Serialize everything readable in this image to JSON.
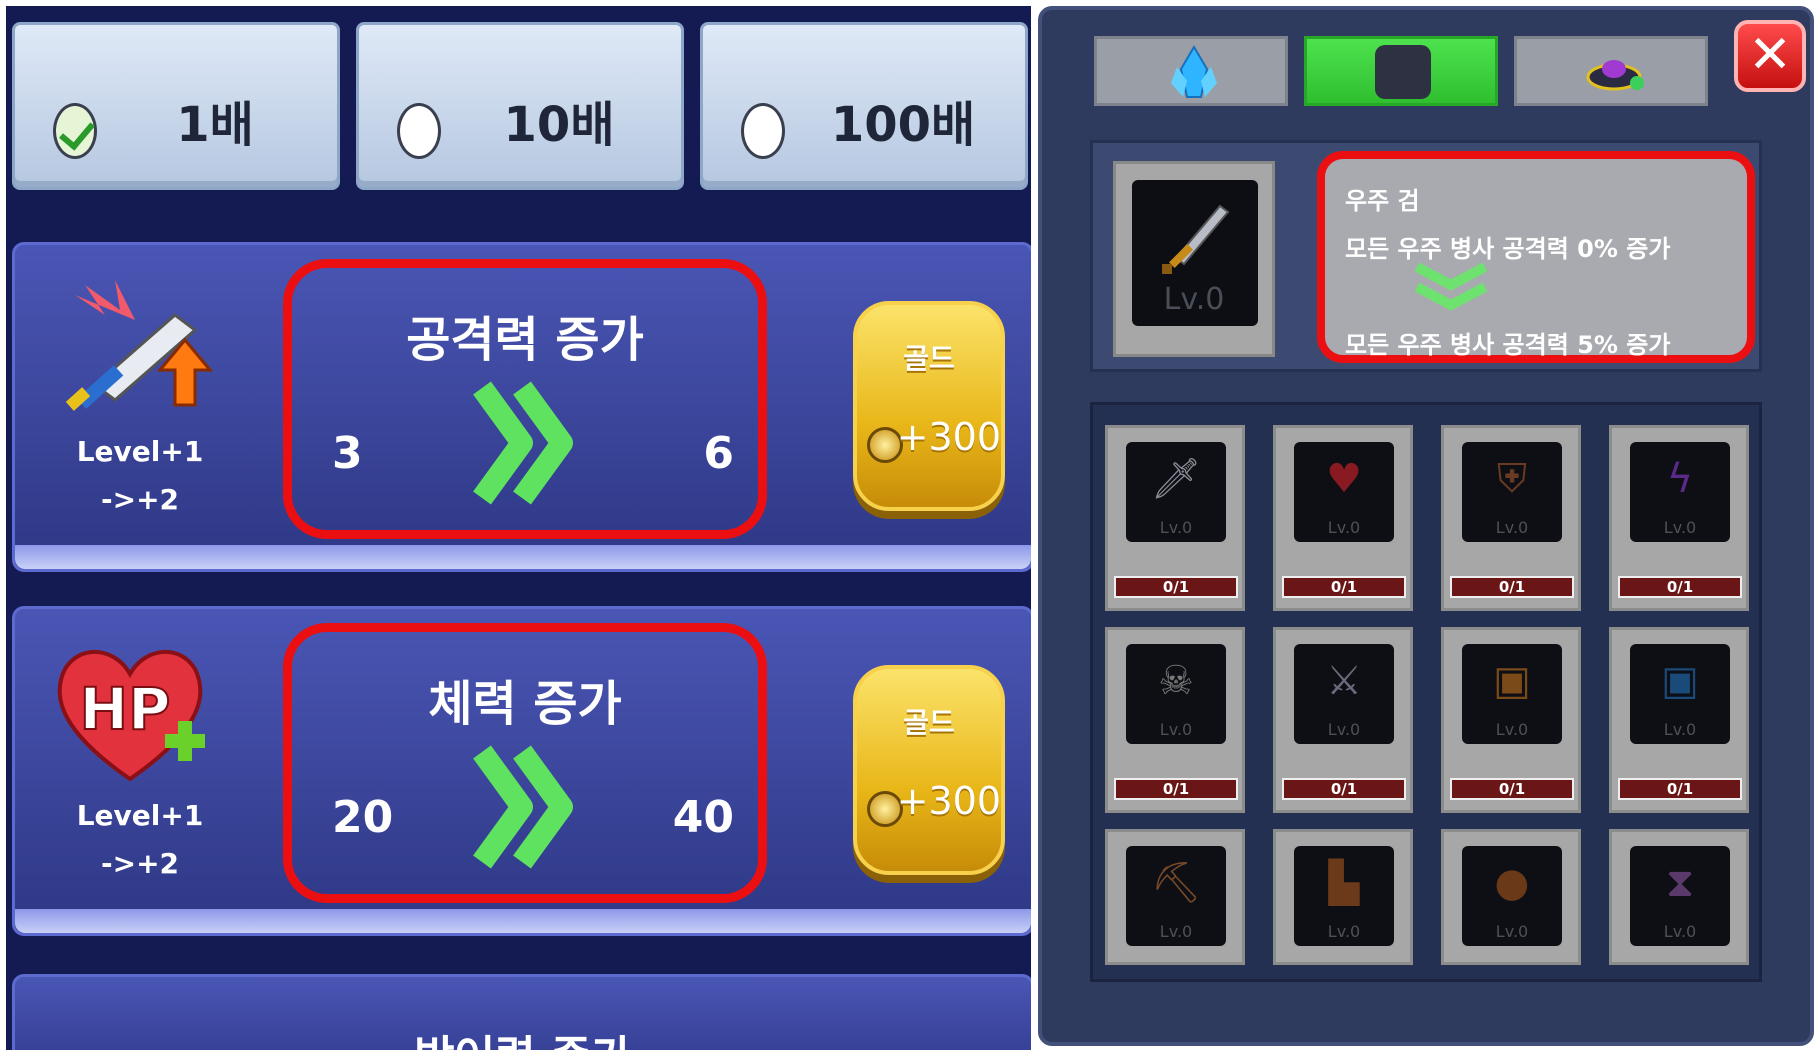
{
  "multiplier_options": [
    {
      "label": "1배",
      "selected": true
    },
    {
      "label": "10배",
      "selected": false
    },
    {
      "label": "100배",
      "selected": false
    }
  ],
  "upgrades": [
    {
      "icon": "sword-upgrade-icon",
      "level_line1": "Level+1",
      "level_line2": "->+2",
      "title": "공격력 증가",
      "from": "3",
      "to": "6",
      "cost_label": "골드",
      "cost": "+300"
    },
    {
      "icon": "hp-heart-icon",
      "level_line1": "Level+1",
      "level_line2": "->+2",
      "title": "체력 증가",
      "from": "20",
      "to": "40",
      "cost_label": "골드",
      "cost": "+300"
    }
  ],
  "partial_card_title": "방어력 증가",
  "equipment_panel": {
    "tabs": [
      {
        "icon": "crystal-icon",
        "active": false
      },
      {
        "icon": "dark-square-icon",
        "active": true
      },
      {
        "icon": "ufo-icon",
        "active": false
      }
    ],
    "close_label": "✕",
    "selected_item": {
      "level": "Lv.0",
      "name": "우주 검",
      "current_effect": "모든 우주 병사 공격력 0% 증가",
      "next_effect": "모든 우주 병사 공격력 5% 증가"
    },
    "items": [
      {
        "icon": "sword-icon",
        "level": "Lv.0",
        "progress": "0/1"
      },
      {
        "icon": "heart-icon",
        "level": "Lv.0",
        "progress": "0/1"
      },
      {
        "icon": "shield-icon",
        "level": "Lv.0",
        "progress": "0/1"
      },
      {
        "icon": "lightning-icon",
        "level": "Lv.0",
        "progress": "0/1"
      },
      {
        "icon": "skull-icon",
        "level": "Lv.0",
        "progress": "0/1"
      },
      {
        "icon": "crossed-swords-icon",
        "level": "Lv.0",
        "progress": "0/1"
      },
      {
        "icon": "treasure-chest-icon",
        "level": "Lv.0",
        "progress": "0/1"
      },
      {
        "icon": "blue-chest-icon",
        "level": "Lv.0",
        "progress": "0/1"
      },
      {
        "icon": "pickaxe-icon",
        "level": "Lv.0"
      },
      {
        "icon": "winged-boot-icon",
        "level": "Lv.0"
      },
      {
        "icon": "money-bag-icon",
        "level": "Lv.0"
      },
      {
        "icon": "hourglass-icon",
        "level": "Lv.0"
      }
    ]
  },
  "colors": {
    "highlight": "#ec0f12",
    "active_tab": "#3fd23f",
    "gold": "#e8b618"
  }
}
